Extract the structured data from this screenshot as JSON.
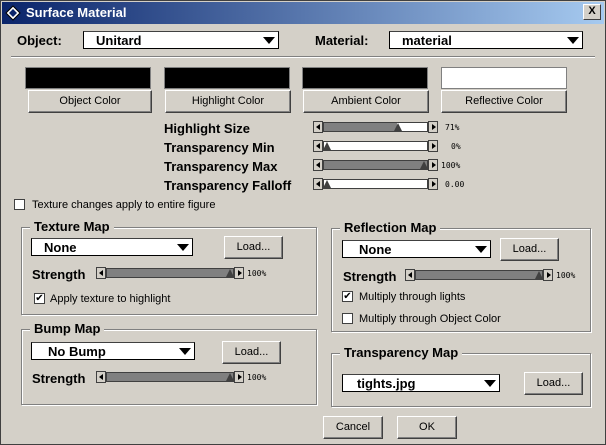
{
  "window": {
    "title": "Surface Material",
    "close_label": "X"
  },
  "header": {
    "object_label": "Object:",
    "object_value": "Unitard",
    "material_label": "Material:",
    "material_value": "material"
  },
  "colors": {
    "object": "#000000",
    "highlight": "#000000",
    "ambient": "#000000",
    "reflective": "#ffffff"
  },
  "color_buttons": [
    "Object Color",
    "Highlight Color",
    "Ambient Color",
    "Reflective Color"
  ],
  "sliders": [
    {
      "label": "Highlight Size",
      "value_text": "71%",
      "fraction": 0.71
    },
    {
      "label": "Transparency Min",
      "value_text": "0%",
      "fraction": 0.0
    },
    {
      "label": "Transparency Max",
      "value_text": "100%",
      "fraction": 1.0
    },
    {
      "label": "Transparency Falloff",
      "value_text": "0.00",
      "fraction": 0.0
    }
  ],
  "texture_global": {
    "label": "Texture changes apply to entire figure",
    "checked": false
  },
  "texture_map": {
    "title": "Texture Map",
    "value": "None",
    "load_label": "Load...",
    "strength_label": "Strength",
    "strength_text": "100%",
    "strength_fraction": 1.0,
    "apply_highlight_label": "Apply texture to highlight",
    "apply_highlight_checked": true
  },
  "bump_map": {
    "title": "Bump Map",
    "value": "No Bump",
    "load_label": "Load...",
    "strength_label": "Strength",
    "strength_text": "100%",
    "strength_fraction": 1.0
  },
  "reflection_map": {
    "title": "Reflection Map",
    "value": "None",
    "load_label": "Load...",
    "strength_label": "Strength",
    "strength_text": "100%",
    "strength_fraction": 1.0,
    "multiply_lights_label": "Multiply through lights",
    "multiply_lights_checked": true,
    "multiply_object_label": "Multiply through Object Color",
    "multiply_object_checked": false
  },
  "transparency_map": {
    "title": "Transparency Map",
    "value": "tights.jpg",
    "load_label": "Load..."
  },
  "footer": {
    "cancel_label": "Cancel",
    "ok_label": "OK"
  }
}
